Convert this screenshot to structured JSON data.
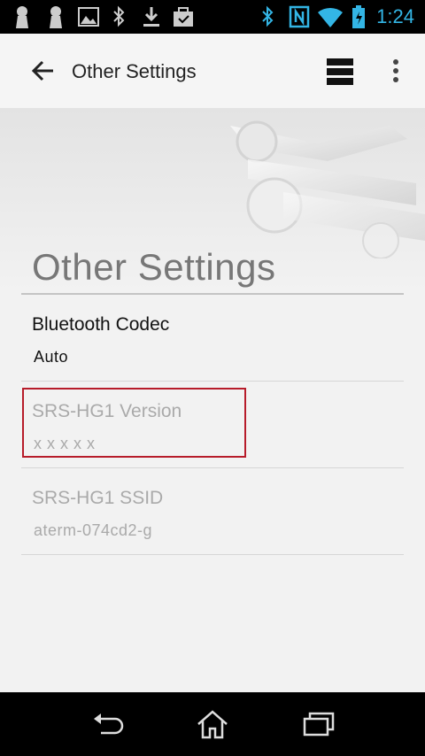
{
  "status_bar": {
    "time": "1:24",
    "icons": [
      "lock-icon",
      "lock-icon",
      "image-icon",
      "bluetooth-icon",
      "download-icon",
      "briefcase-icon",
      "bluetooth-icon",
      "nfc-icon",
      "wifi-icon",
      "battery-icon"
    ],
    "time_color": "#33b5e5"
  },
  "app_bar": {
    "title": "Other Settings",
    "back_icon": "arrow-back-icon",
    "layers_icon": "layers-icon",
    "overflow_icon": "more-vert-icon"
  },
  "page": {
    "heading": "Other Settings",
    "hero_icon": "wrench-icon"
  },
  "settings": [
    {
      "title": "Bluetooth Codec",
      "value": "Auto",
      "enabled": true
    },
    {
      "title": "SRS-HG1 Version",
      "value": "x x x x x",
      "enabled": false
    },
    {
      "title": "SRS-HG1 SSID",
      "value": "aterm-074cd2-g",
      "enabled": false
    }
  ],
  "highlight_color": "#b71c2a",
  "nav_bar": {
    "buttons": [
      "back-icon",
      "home-icon",
      "recents-icon"
    ]
  }
}
